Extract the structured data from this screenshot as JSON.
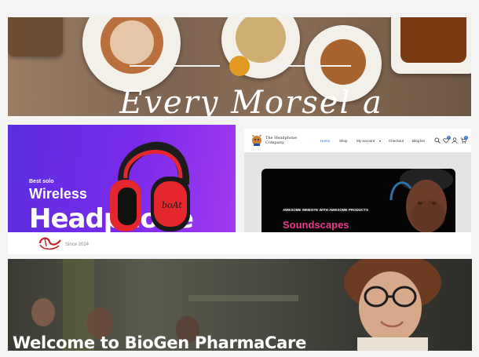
{
  "food_hero": {
    "script_title": "Every Morsel a"
  },
  "headphone_banner": {
    "eyebrow": "Best solo",
    "title_line_1": "Wireless",
    "title_line_2": "Headphone",
    "product_brand": "boAt"
  },
  "shop_site": {
    "logo_text": "The Headphone Company",
    "nav": [
      "Home",
      "Shop",
      "My account",
      "Checkout",
      "Blog list"
    ],
    "cart_count": "0",
    "wishlist_count": "0",
    "hero_tagline": "AWESOME WEBSITE WITH AWESOME PRODUCTS",
    "hero_headline": "Soundscapes",
    "accent_color": "#e93c8c",
    "nav_active_color": "#2b6fd6"
  },
  "logo_strip": {
    "since": "Since 2024"
  },
  "pharma_hero": {
    "title": "Welcome to BioGen PharmaCare"
  },
  "colors": {
    "hero_dot": "#e39a24",
    "banner_purple": "#6a2be6"
  }
}
